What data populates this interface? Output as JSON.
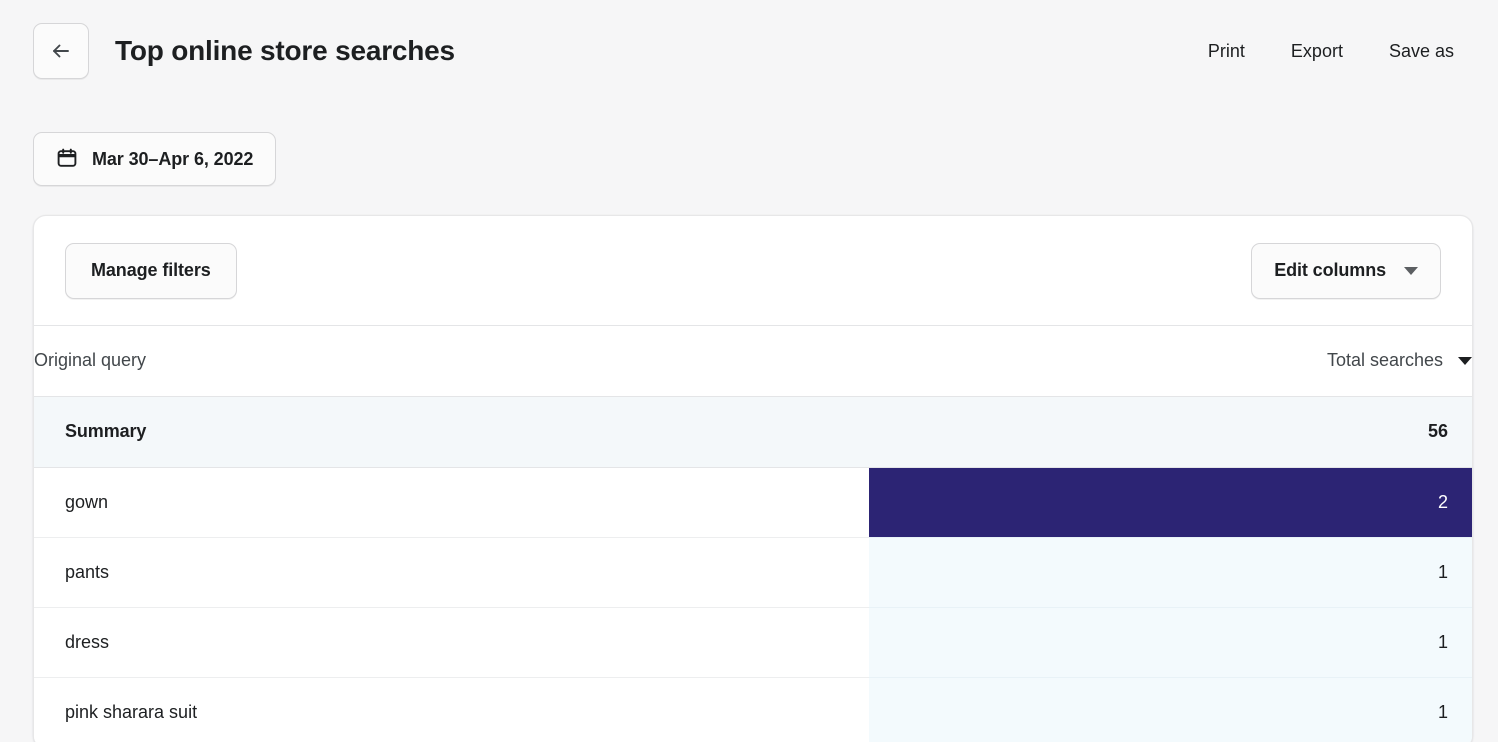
{
  "header": {
    "back_icon": "arrow-left-icon",
    "title": "Top online store searches",
    "actions": [
      {
        "label": "Print",
        "name": "print"
      },
      {
        "label": "Export",
        "name": "export"
      },
      {
        "label": "Save as",
        "name": "save-as"
      }
    ]
  },
  "date_filter": {
    "icon": "calendar-icon",
    "label": "Mar 30–Apr 6, 2022"
  },
  "toolbar": {
    "manage_filters_label": "Manage filters",
    "edit_columns_label": "Edit columns",
    "edit_columns_icon": "chevron-down-icon"
  },
  "table": {
    "columns": {
      "query_header": "Original query",
      "value_header": "Total searches",
      "sort_icon": "chevron-down-icon"
    },
    "summary": {
      "label": "Summary",
      "value": "56"
    },
    "rows": [
      {
        "query": "gown",
        "value": "2",
        "bar_pct": 100
      },
      {
        "query": "pants",
        "value": "1",
        "bar_pct": 0
      },
      {
        "query": "dress",
        "value": "1",
        "bar_pct": 0
      },
      {
        "query": "pink sharara suit",
        "value": "1",
        "bar_pct": 0
      }
    ]
  },
  "colors": {
    "bar_fill": "#2c2474",
    "bar_track": "#f3fafd",
    "summary_bg": "#f4f8fa",
    "page_bg": "#f6f6f7"
  }
}
